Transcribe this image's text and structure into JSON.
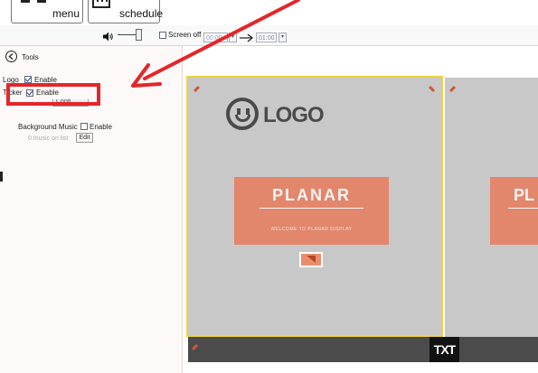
{
  "toolbar": {
    "menu_label": "menu",
    "schedule_label": "schedule"
  },
  "controls": {
    "screen_off_label": "Screen off",
    "time_from": "00:00",
    "time_to": "01:00"
  },
  "sidebar": {
    "tools_label": "Tools",
    "logo_label": "Logo",
    "logo_enable": "Enable",
    "ticker_label": "Ticker",
    "ticker_enable": "Enable",
    "ticker_button": "Confi...",
    "bg_music_label": "Background Music",
    "bg_music_enable": "Enable",
    "music_list_text": "0  music on list",
    "edit_button": "Edit"
  },
  "stage": {
    "logo_text": "LOGO",
    "banner_text": "PLANAR",
    "banner_subtext": "WELCOME TO PLANAR DISPLAY",
    "banner_text_2": "PL",
    "ticker_text": "TXT"
  },
  "colors": {
    "annotation_red": "#e3262b",
    "selection_border": "#f0d338",
    "placeholder_gray": "#c8c8c8",
    "banner_orange": "#e2876c",
    "ticker_bar": "#4b4b4b"
  }
}
